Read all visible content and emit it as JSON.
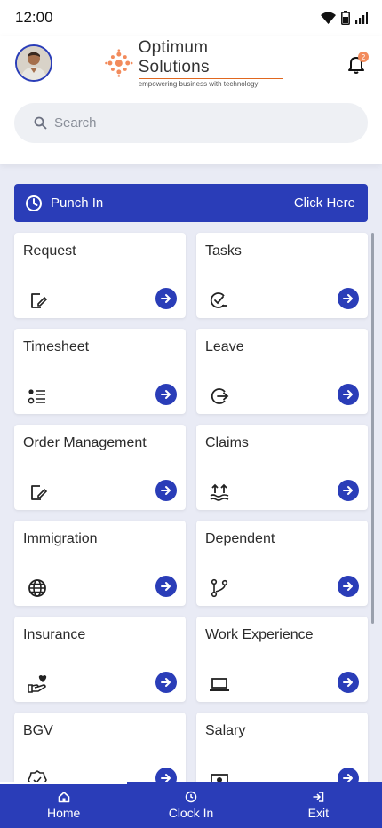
{
  "status": {
    "time": "12:00"
  },
  "header": {
    "brand_title": "Optimum Solutions",
    "brand_tagline": "empowering business with technology",
    "notification_count": "2"
  },
  "search": {
    "placeholder": "Search"
  },
  "punch": {
    "label": "Punch In",
    "action": "Click Here"
  },
  "cards": [
    {
      "label": "Request",
      "icon": "edit-document-icon"
    },
    {
      "label": "Tasks",
      "icon": "task-check-icon"
    },
    {
      "label": "Timesheet",
      "icon": "list-icon"
    },
    {
      "label": "Leave",
      "icon": "logout-circle-icon"
    },
    {
      "label": "Order Management",
      "icon": "edit-document-icon"
    },
    {
      "label": "Claims",
      "icon": "claims-arrows-icon"
    },
    {
      "label": "Immigration",
      "icon": "globe-icon"
    },
    {
      "label": "Dependent",
      "icon": "fork-icon"
    },
    {
      "label": "Insurance",
      "icon": "hand-heart-icon"
    },
    {
      "label": "Work Experience",
      "icon": "laptop-icon"
    },
    {
      "label": "BGV",
      "icon": "badge-check-icon"
    },
    {
      "label": "Salary",
      "icon": "money-icon"
    }
  ],
  "nav": [
    {
      "label": "Home",
      "icon": "home-icon"
    },
    {
      "label": "Clock In",
      "icon": "clock-icon"
    },
    {
      "label": "Exit",
      "icon": "exit-icon"
    }
  ],
  "colors": {
    "primary": "#2a3db8",
    "background": "#e9ebf5",
    "badge": "#f28b5c"
  }
}
